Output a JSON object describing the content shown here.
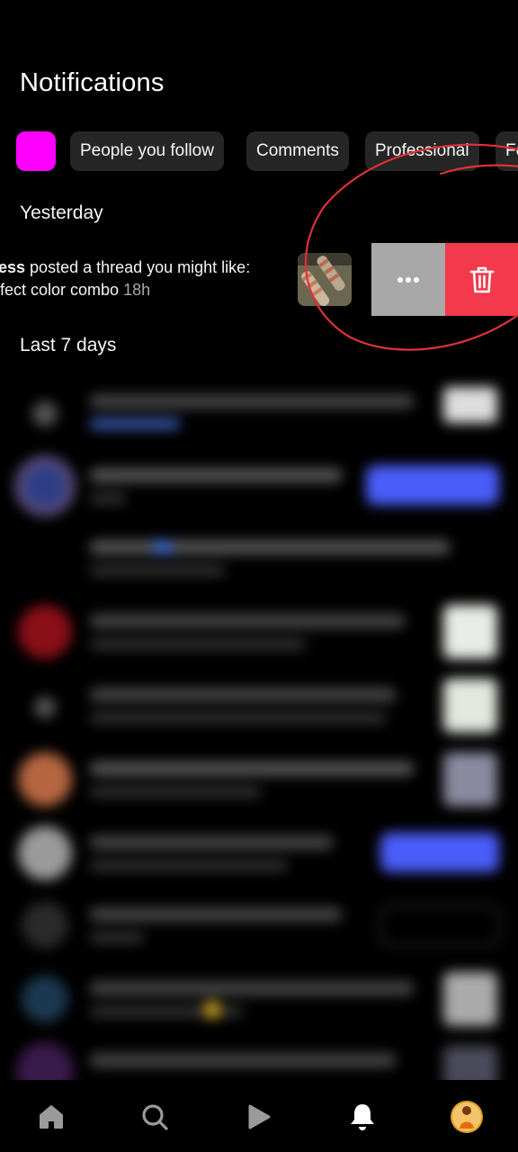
{
  "page": {
    "title": "Notifications"
  },
  "filters": [
    {
      "label": ""
    },
    {
      "label": "People you follow"
    },
    {
      "label": "Comments"
    },
    {
      "label": "Professional"
    },
    {
      "label": "Fo"
    }
  ],
  "sections": {
    "yesterday": "Yesterday",
    "last7": "Last 7 days"
  },
  "notification": {
    "user": "ess",
    "line1_rest": " posted a thread you might like:",
    "line2": "fect color combo",
    "time": "18h"
  },
  "swipe_actions": {
    "more_icon": "more-horizontal-icon",
    "delete_icon": "trash-icon"
  },
  "colors": {
    "accent_chip": "#ff00ff",
    "delete": "#f23a4c",
    "more": "#a8a8a8",
    "annotation": "#e0303a",
    "follow_button": "#4a5df9"
  },
  "bottom_nav": [
    "home-icon",
    "search-icon",
    "reels-icon",
    "notifications-icon",
    "profile-avatar"
  ]
}
